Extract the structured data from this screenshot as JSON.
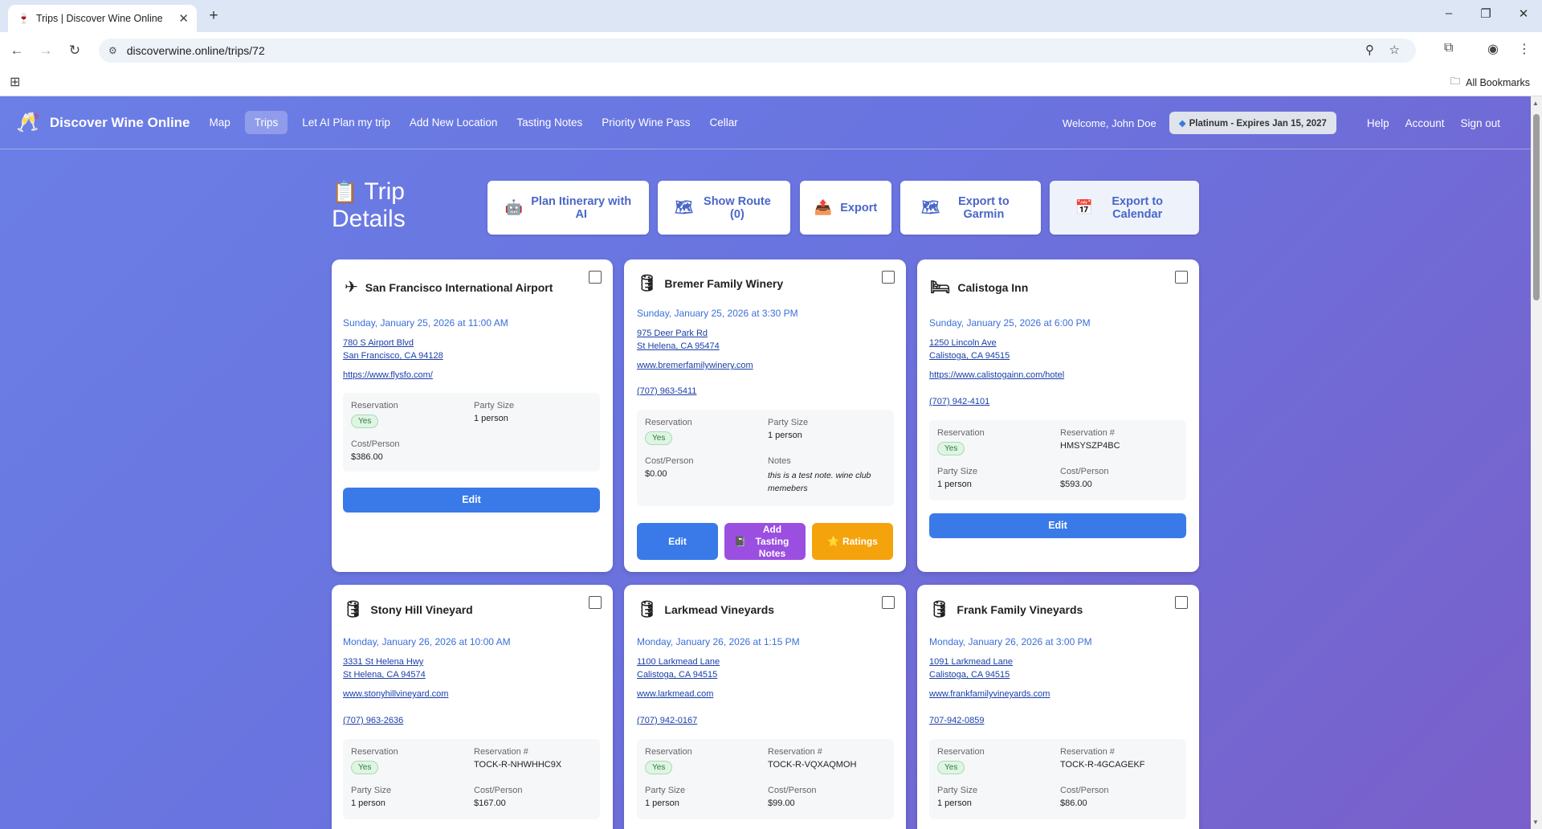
{
  "browser": {
    "tab_title": "Trips | Discover Wine Online",
    "url": "discoverwine.online/trips/72",
    "all_bookmarks": "All Bookmarks"
  },
  "nav": {
    "brand": "Discover Wine Online",
    "links": [
      "Map",
      "Trips",
      "Let AI Plan my trip",
      "Add New Location",
      "Tasting Notes",
      "Priority Wine Pass",
      "Cellar"
    ],
    "welcome": "Welcome, John Doe",
    "membership": "Platinum - Expires Jan 15, 2027",
    "right_links": [
      "Help",
      "Account",
      "Sign out"
    ]
  },
  "header": {
    "title_line1": "Trip",
    "title_line2": "Details",
    "actions": {
      "plan_ai": "Plan Itinerary with AI",
      "show_route": "Show Route (0)",
      "export": "Export",
      "export_garmin": "Export to Garmin",
      "export_calendar": "Export to Calendar"
    }
  },
  "labels": {
    "reservation": "Reservation",
    "party_size": "Party Size",
    "cost_person": "Cost/Person",
    "reservation_num": "Reservation #",
    "notes": "Notes",
    "yes": "Yes",
    "edit": "Edit",
    "add_tasting_notes": "Add Tasting Notes",
    "ratings": "Ratings"
  },
  "cards": [
    {
      "name": "San Francisco International Airport",
      "icon": "airplane-icon",
      "date": "Sunday, January 25, 2026 at 11:00 AM",
      "addr1": "780 S Airport Blvd",
      "addr2": "San Francisco, CA 94128",
      "website": "https://www.flysfo.com/",
      "reservation": "Yes",
      "party_size": "1 person",
      "cost": "$386.00"
    },
    {
      "name": "Bremer Family Winery",
      "icon": "barrel-icon",
      "date": "Sunday, January 25, 2026 at 3:30 PM",
      "addr1": "975 Deer Park Rd",
      "addr2": "St Helena, CA 95474",
      "website": "www.bremerfamilywinery.com",
      "phone": "(707) 963-5411",
      "reservation": "Yes",
      "party_size": "1 person",
      "cost": "$0.00",
      "notes": "this is a test note. wine club memebers"
    },
    {
      "name": "Calistoga Inn",
      "icon": "bed-icon",
      "date": "Sunday, January 25, 2026 at 6:00 PM",
      "addr1": "1250 Lincoln Ave",
      "addr2": "Calistoga, CA 94515",
      "website": "https://www.calistogainn.com/hotel",
      "phone": "(707) 942-4101",
      "reservation": "Yes",
      "reservation_num": "HMSYSZP4BC",
      "party_size": "1 person",
      "cost": "$593.00"
    },
    {
      "name": "Stony Hill Vineyard",
      "icon": "barrel-icon",
      "date": "Monday, January 26, 2026 at 10:00 AM",
      "addr1": "3331 St Helena Hwy",
      "addr2": "St Helena, CA 94574",
      "website": "www.stonyhillvineyard.com",
      "phone": "(707) 963-2636",
      "reservation": "Yes",
      "reservation_num": "TOCK-R-NHWHHC9X",
      "party_size": "1 person",
      "cost": "$167.00"
    },
    {
      "name": "Larkmead Vineyards",
      "icon": "barrel-icon",
      "date": "Monday, January 26, 2026 at 1:15 PM",
      "addr1": "1100 Larkmead Lane",
      "addr2": "Calistoga, CA 94515",
      "website": "www.larkmead.com",
      "phone": "(707) 942-0167",
      "reservation": "Yes",
      "reservation_num": "TOCK-R-VQXAQMOH",
      "party_size": "1 person",
      "cost": "$99.00"
    },
    {
      "name": "Frank Family Vineyards",
      "icon": "barrel-icon",
      "date": "Monday, January 26, 2026 at 3:00 PM",
      "addr1": "1091 Larkmead Lane",
      "addr2": "Calistoga, CA 94515",
      "website": "www.frankfamilyvineyards.com",
      "phone": "707-942-0859",
      "reservation": "Yes",
      "reservation_num": "TOCK-R-4GCAGEKF",
      "party_size": "1 person",
      "cost": "$86.00"
    }
  ],
  "colors": {
    "page_gradient_start": "#6b7fe6",
    "page_gradient_end": "#7a5fc9",
    "edit_button": "#3a7ae8",
    "tasting_button": "#9b4fe0",
    "ratings_button": "#f5a30c",
    "date_text": "#3a6fd8"
  }
}
